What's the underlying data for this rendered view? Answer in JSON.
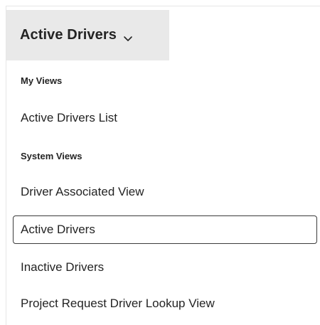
{
  "view_selector": {
    "label": "Active Drivers",
    "chevron_icon": "chevron-down-icon"
  },
  "menu": {
    "groups": [
      {
        "header": "My Views",
        "items": [
          {
            "label": "Active Drivers List",
            "selected": false
          }
        ]
      },
      {
        "header": "System Views",
        "items": [
          {
            "label": "Driver Associated View",
            "selected": false
          },
          {
            "label": "Active Drivers",
            "selected": true
          },
          {
            "label": "Inactive Drivers",
            "selected": false
          },
          {
            "label": "Project Request Driver Lookup View",
            "selected": false
          }
        ]
      }
    ]
  },
  "colors": {
    "selector_background": "#e9e9e9",
    "text": "#242424",
    "selected_border": "#3b3b3b"
  }
}
